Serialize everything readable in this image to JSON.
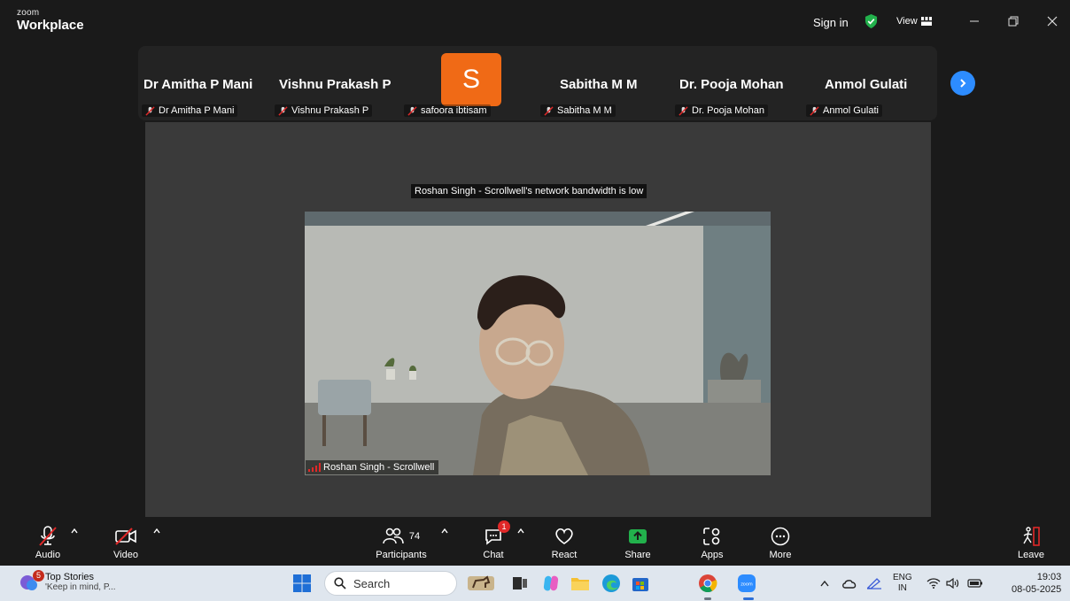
{
  "titlebar": {
    "brand_small": "zoom",
    "brand_large": "Workplace",
    "sign_in": "Sign in",
    "view": "View"
  },
  "strip": {
    "participants": [
      {
        "name": "Dr Amitha P Mani",
        "label": "Dr Amitha P Mani"
      },
      {
        "name": "Vishnu Prakash P",
        "label": "Vishnu Prakash P"
      },
      {
        "name": "",
        "label": "safoora ibtisam",
        "avatar_letter": "S",
        "avatar_color": "#f06a16"
      },
      {
        "name": "Sabitha M M",
        "label": "Sabitha M M"
      },
      {
        "name": "Dr. Pooja Mohan",
        "label": "Dr. Pooja Mohan"
      },
      {
        "name": "Anmol Gulati",
        "label": "Anmol Gulati"
      }
    ]
  },
  "stage": {
    "notice": "Roshan Singh - Scrollwell's network bandwidth is low",
    "speaker_label": "Roshan Singh - Scrollwell"
  },
  "toolbar": {
    "audio": "Audio",
    "video": "Video",
    "participants": "Participants",
    "participants_count": "74",
    "chat": "Chat",
    "chat_badge": "1",
    "react": "React",
    "share": "Share",
    "apps": "Apps",
    "more": "More",
    "leave": "Leave"
  },
  "taskbar": {
    "news_badge": "5",
    "news_title": "Top Stories",
    "news_subtitle": "'Keep in mind, P...",
    "search_placeholder": "Search",
    "lang_top": "ENG",
    "lang_bottom": "IN",
    "time": "19:03",
    "date": "08-05-2025"
  },
  "colors": {
    "accent_blue": "#2d8cff",
    "share_green": "#22b14c",
    "mute_red": "#e02828",
    "avatar_orange": "#f06a16"
  }
}
